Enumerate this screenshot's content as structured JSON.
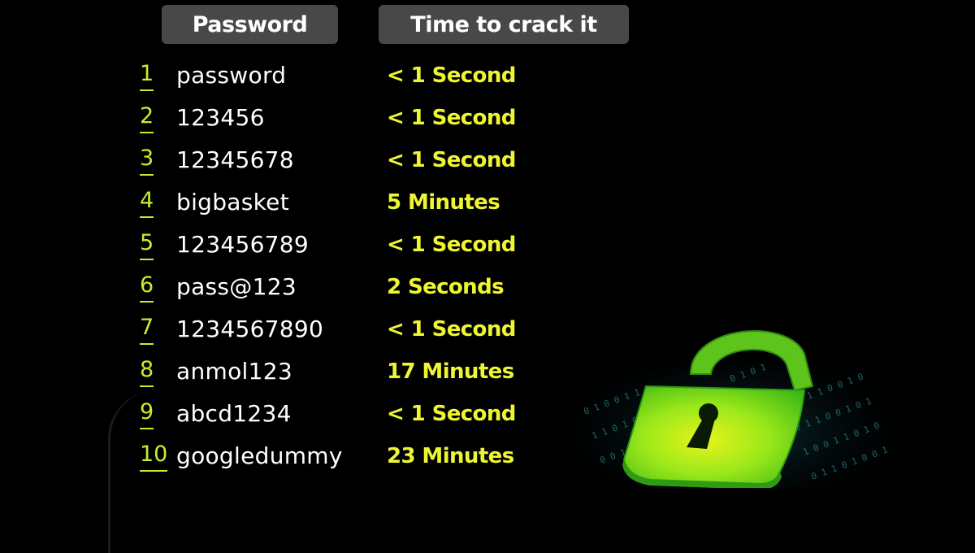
{
  "header": {
    "password_label": "Password",
    "time_label": "Time to crack it"
  },
  "colors": {
    "background": "#000000",
    "header_pill": "#484848",
    "rank_number": "#c6ee2e",
    "password_text": "#ffffff",
    "crack_time": "#eef531",
    "lock_green": "#7ee81c"
  },
  "rows": [
    {
      "rank": "1",
      "password": "password",
      "time": "< 1 Second"
    },
    {
      "rank": "2",
      "password": "123456",
      "time": "< 1 Second"
    },
    {
      "rank": "3",
      "password": "12345678",
      "time": "< 1 Second"
    },
    {
      "rank": "4",
      "password": "bigbasket",
      "time": "5 Minutes"
    },
    {
      "rank": "5",
      "password": "123456789",
      "time": "< 1 Second"
    },
    {
      "rank": "6",
      "password": "pass@123",
      "time": "2 Seconds"
    },
    {
      "rank": "7",
      "password": "1234567890",
      "time": "< 1 Second"
    },
    {
      "rank": "8",
      "password": "anmol123",
      "time": "17 Minutes"
    },
    {
      "rank": "9",
      "password": "abcd1234",
      "time": "< 1 Second"
    },
    {
      "rank": "10",
      "password": "googledummy",
      "time": "23 Minutes"
    }
  ],
  "illustration": {
    "icon": "open-padlock-icon",
    "background_pattern": "binary-digits"
  }
}
